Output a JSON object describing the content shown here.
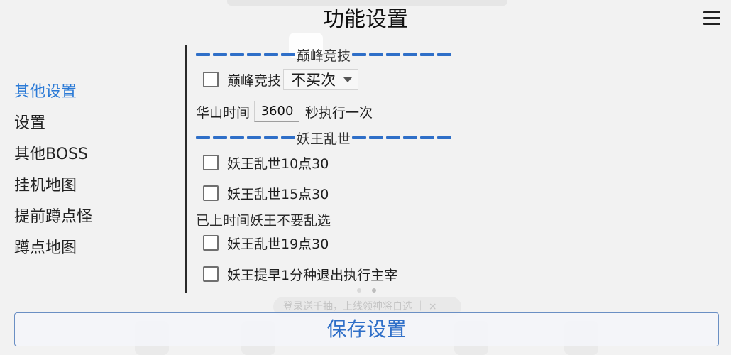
{
  "header": {
    "title": "功能设置",
    "menu_icon": "hamburger-menu-icon"
  },
  "sidebar": {
    "items": [
      {
        "label": "其他设置",
        "active": true
      },
      {
        "label": "设置",
        "active": false
      },
      {
        "label": "其他BOSS",
        "active": false
      },
      {
        "label": "挂机地图",
        "active": false
      },
      {
        "label": "提前蹲点怪",
        "active": false
      },
      {
        "label": "蹲点地图",
        "active": false
      }
    ],
    "active_color": "#2979d6"
  },
  "sections": {
    "peak": {
      "title": "巅峰竞技",
      "checkbox_label": "巅峰竞技",
      "checked": false,
      "select_value": "不买次"
    },
    "huashan": {
      "prefix": "华山时间",
      "value": "3600",
      "suffix": "秒执行一次"
    },
    "yaowang": {
      "title": "妖王乱世",
      "opt_1030": {
        "label": "妖王乱世10点30",
        "checked": false
      },
      "opt_1530": {
        "label": "妖王乱世15点30",
        "checked": false
      },
      "note": "已上时间妖王不要乱选",
      "opt_1930": {
        "label": "妖王乱世19点30",
        "checked": false
      },
      "opt_early": {
        "label": "妖王提早1分种退出执行主宰",
        "checked": false
      }
    }
  },
  "footer": {
    "save_label": "保存设置"
  },
  "background": {
    "toast_text": "登录送千抽，上线领神将自选 ｜ ×"
  },
  "colors": {
    "accent": "#2f6fc8",
    "background": "#f2f2f2"
  }
}
